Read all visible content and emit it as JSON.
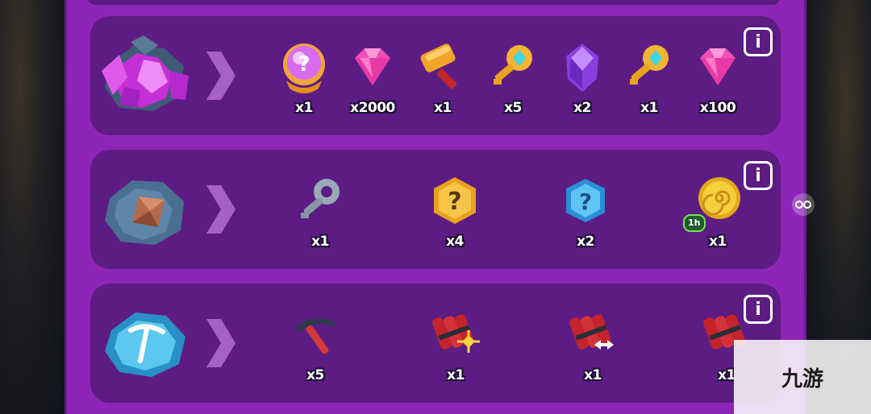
{
  "rows": [
    {
      "rewards": [
        {
          "icon": "mystery-orb-icon",
          "qty": "x1"
        },
        {
          "icon": "pink-gem-icon",
          "qty": "x2000"
        },
        {
          "icon": "golden-hammer-icon",
          "qty": "x1"
        },
        {
          "icon": "golden-key-icon",
          "qty": "x5"
        },
        {
          "icon": "purple-crystal-icon",
          "qty": "x2"
        },
        {
          "icon": "golden-key-icon",
          "qty": "x1"
        },
        {
          "icon": "pink-gem-icon",
          "qty": "x100"
        }
      ]
    },
    {
      "rewards": [
        {
          "icon": "silver-key-icon",
          "qty": "x1"
        },
        {
          "icon": "gold-mystery-hexagon-icon",
          "qty": "x4"
        },
        {
          "icon": "blue-mystery-hexagon-icon",
          "qty": "x2"
        },
        {
          "icon": "gold-coin-spiral-icon",
          "qty": "x1",
          "badge": "1h"
        }
      ]
    },
    {
      "rewards": [
        {
          "icon": "pickaxe-icon",
          "qty": "x5"
        },
        {
          "icon": "dynamite-move-icon",
          "qty": "x1"
        },
        {
          "icon": "dynamite-horizontal-icon",
          "qty": "x1"
        },
        {
          "icon": "dynamite-icon",
          "qty": "x1"
        }
      ]
    }
  ],
  "info_label": "i",
  "watermark": "九游",
  "colors": {
    "panel": "#8e25b8",
    "row": "#5c1c83",
    "text_outline": "#1b1030"
  }
}
